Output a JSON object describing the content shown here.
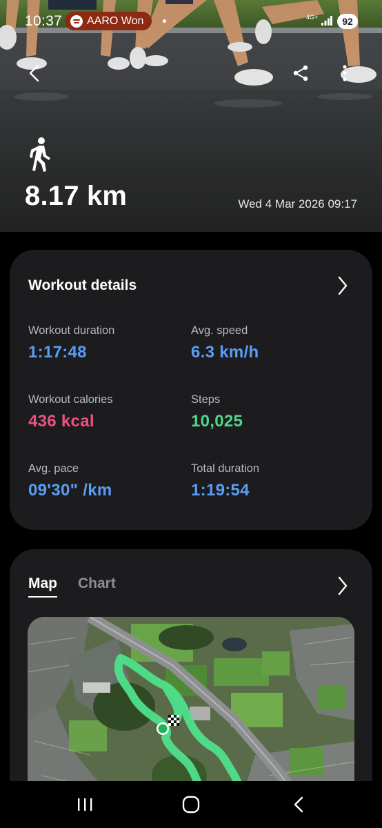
{
  "status_bar": {
    "time": "10:37",
    "media_text": "AARO Won",
    "network": "4G+",
    "battery": "92"
  },
  "hero": {
    "distance": "8.17 km",
    "date": "Wed 4 Mar 2026 09:17",
    "activity_icon": "walk-icon"
  },
  "workout_details": {
    "title": "Workout details",
    "stats": {
      "duration": {
        "label": "Workout duration",
        "value": "1:17:48"
      },
      "speed": {
        "label": "Avg. speed",
        "value": "6.3 km/h"
      },
      "calories": {
        "label": "Workout calories",
        "value": "436 kcal"
      },
      "steps": {
        "label": "Steps",
        "value": "10,025"
      },
      "pace": {
        "label": "Avg. pace",
        "value": "09'30\" /km"
      },
      "total": {
        "label": "Total duration",
        "value": "1:19:54"
      }
    }
  },
  "map_section": {
    "tabs": [
      "Map",
      "Chart"
    ],
    "active_tab": "Map"
  },
  "colors": {
    "card_bg": "#1c1c1e",
    "blue_value": "#5a9df5",
    "pink_value": "#f0507e",
    "green_value": "#4fd68a",
    "route": "#4ee08a",
    "media_pill": "#8c2a12"
  },
  "icons": [
    "back-arrow-icon",
    "share-icon",
    "more-vert-icon",
    "chevron-right-icon",
    "spotify-icon",
    "signal-icon",
    "nav-recents-icon",
    "nav-home-icon",
    "nav-back-icon"
  ]
}
